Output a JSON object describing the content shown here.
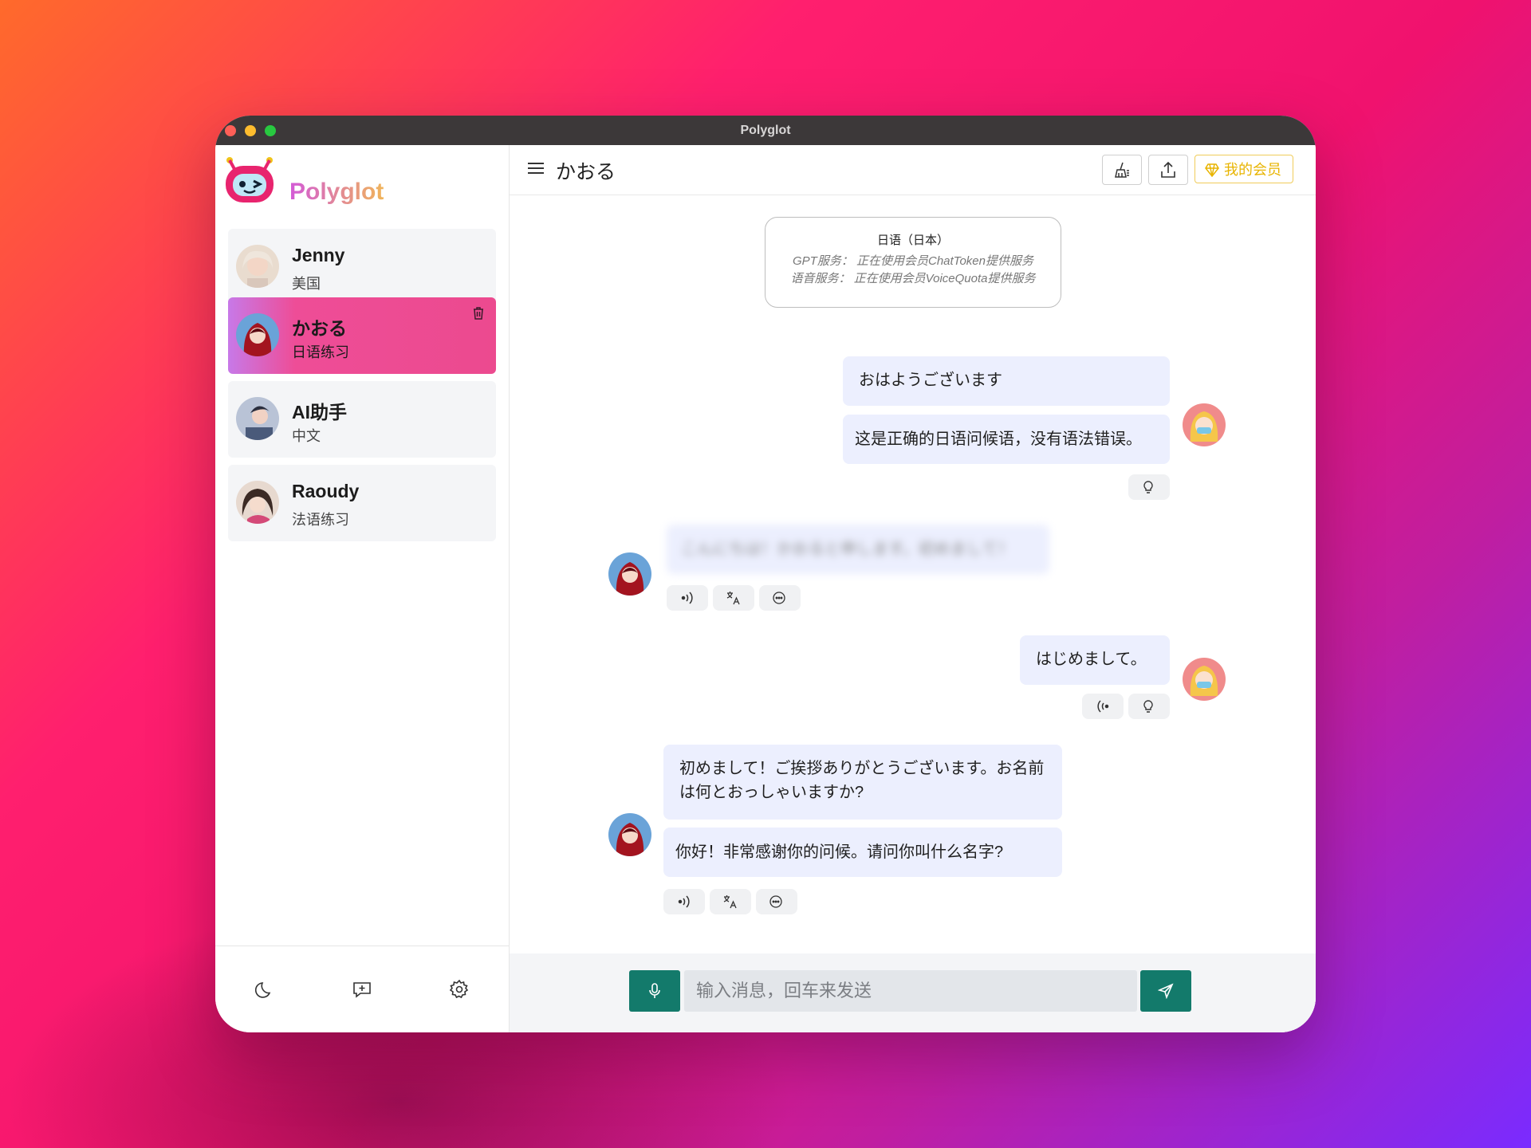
{
  "window": {
    "title": "Polyglot"
  },
  "app": {
    "name": "Polyglot"
  },
  "sidebar": {
    "conversations": [
      {
        "name": "Jenny",
        "subtitle": "美国"
      },
      {
        "name": "かおる",
        "subtitle": "日语练习",
        "active": true
      },
      {
        "name": "AI助手",
        "subtitle": "中文"
      },
      {
        "name": "Raoudy",
        "subtitle": "法语练习"
      }
    ],
    "bottom_icons": [
      "moon-icon",
      "new-chat-icon",
      "gear-icon"
    ]
  },
  "header": {
    "title": "かおる",
    "membership_label": "我的会员"
  },
  "info_card": {
    "language": "日语（日本）",
    "gpt_service": "GPT服务：  正在使用会员ChatToken提供服务",
    "voice_service": "语音服务：  正在使用会员VoiceQuota提供服务"
  },
  "messages": [
    {
      "role": "user",
      "text": "おはようございます",
      "correction": "这是正确的日语问候语，没有语法错误。"
    },
    {
      "role": "assistant",
      "text": "こんにちは！かおると申します。初めまして！",
      "blurred": true
    },
    {
      "role": "user",
      "text": "はじめまして。"
    },
    {
      "role": "assistant",
      "text": "初めまして！ご挨拶ありがとうございます。お名前は何とおっしゃいますか?",
      "translation": "你好！非常感谢你的问候。请问你叫什么名字?"
    }
  ],
  "composer": {
    "placeholder": "输入消息，回车来发送"
  },
  "colors": {
    "accent": "#137a6b",
    "active_item": "#ec4a8f",
    "bubble": "#eceffe",
    "vip": "#e8b400"
  }
}
